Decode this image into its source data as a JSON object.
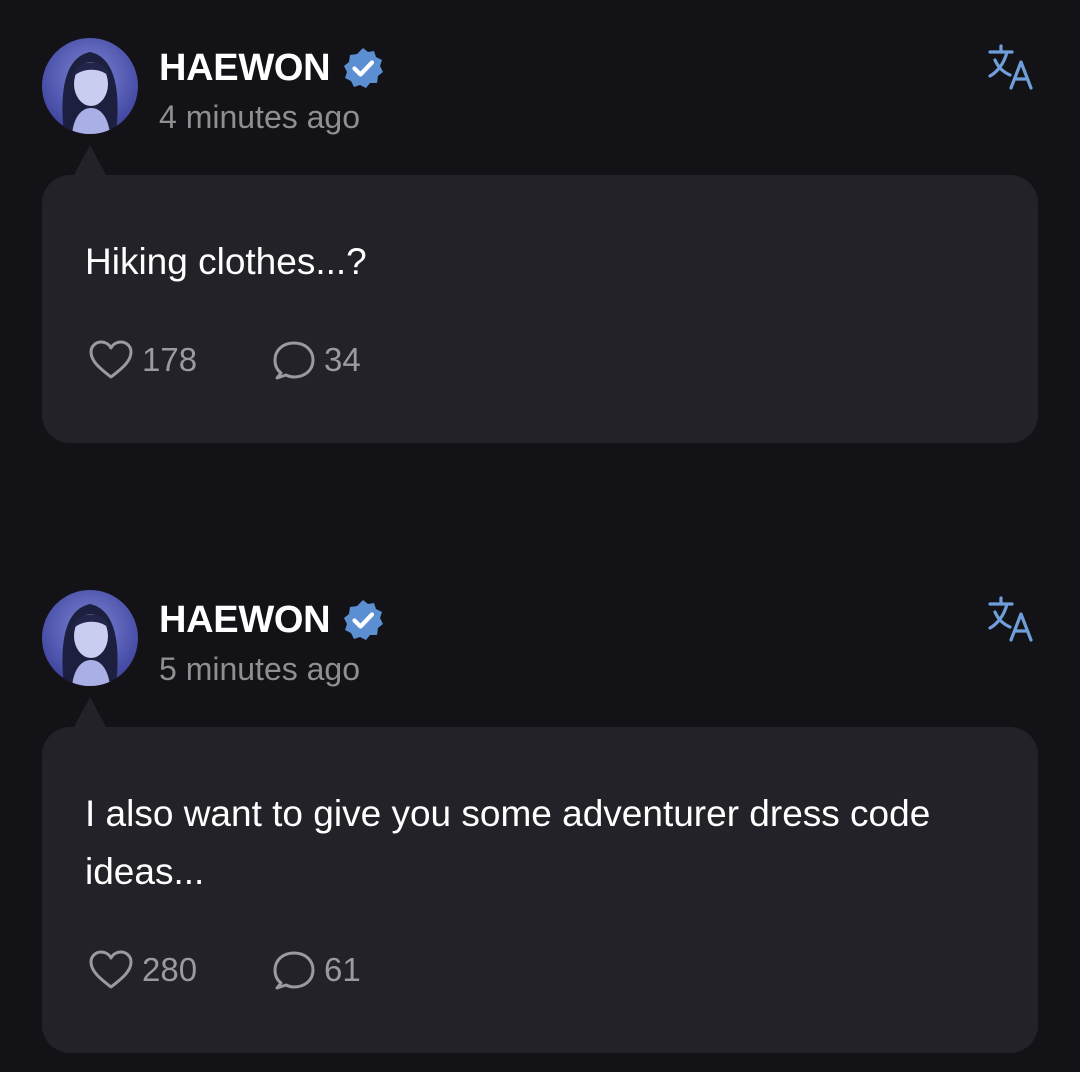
{
  "colors": {
    "background": "#131317",
    "bubble": "#222228",
    "verified_badge": "#5b8fd1",
    "translate_icon": "#6f9fd9",
    "muted_text": "#8e8e93"
  },
  "posts": [
    {
      "author": "HAEWON",
      "verified": true,
      "timestamp": "4 minutes ago",
      "text": "Hiking clothes...?",
      "likes": "178",
      "comments": "34",
      "icons": {
        "avatar": "avatar",
        "badge": "verified-badge-icon",
        "translate": "translate-icon",
        "like": "heart-icon",
        "comment": "comment-bubble-icon"
      }
    },
    {
      "author": "HAEWON",
      "verified": true,
      "timestamp": "5 minutes ago",
      "text": "I also want to give you some adventurer dress code ideas...",
      "likes": "280",
      "comments": "61",
      "icons": {
        "avatar": "avatar",
        "badge": "verified-badge-icon",
        "translate": "translate-icon",
        "like": "heart-icon",
        "comment": "comment-bubble-icon"
      }
    }
  ]
}
